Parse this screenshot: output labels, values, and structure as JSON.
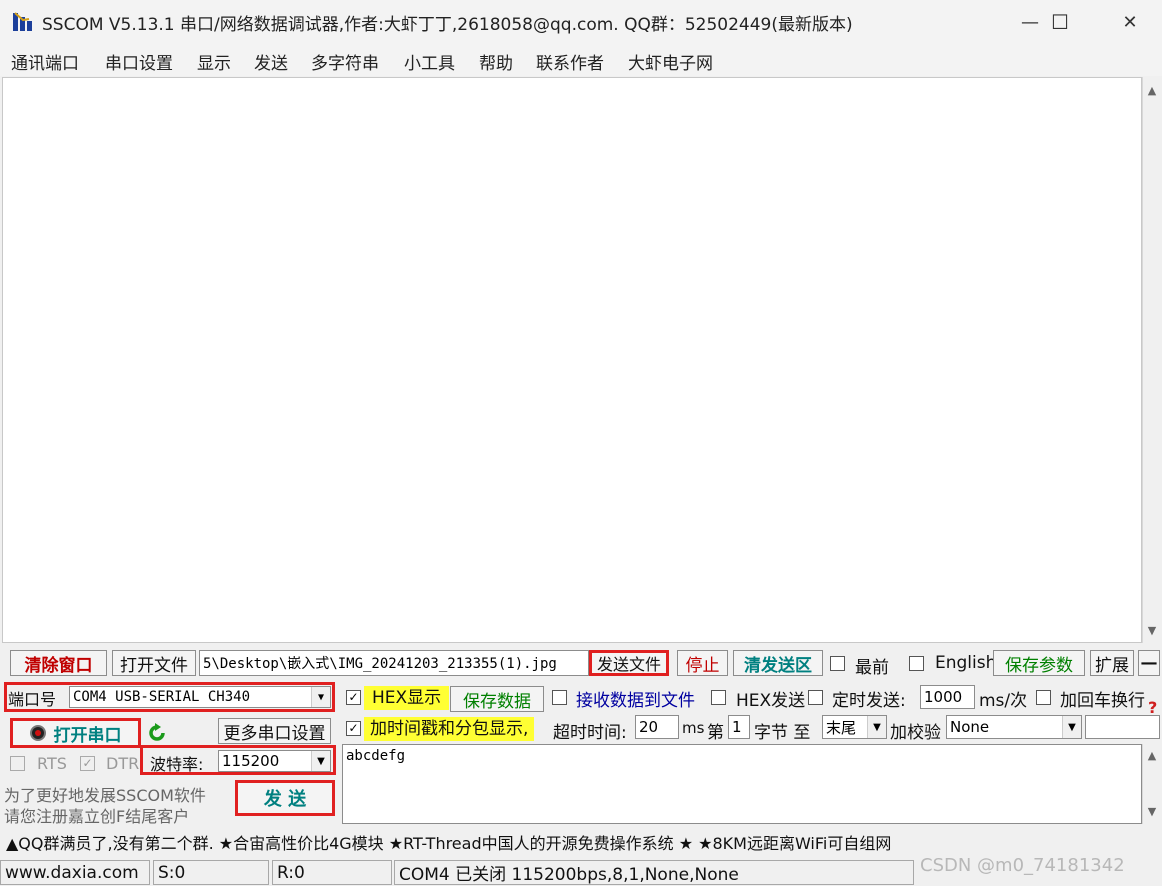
{
  "window": {
    "title": "SSCOM V5.13.1 串口/网络数据调试器,作者:大虾丁丁,2618058@qq.com. QQ群：52502449(最新版本)",
    "minimize": "—",
    "maximize": "☐",
    "close": "✕"
  },
  "menu": [
    "通讯端口",
    "串口设置",
    "显示",
    "发送",
    "多字符串",
    "小工具",
    "帮助",
    "联系作者",
    "大虾电子网"
  ],
  "toolbar": {
    "clear_window": "清除窗口",
    "open_file": "打开文件",
    "file_path": "5\\Desktop\\嵌入式\\IMG_20241203_213355(1).jpg",
    "send_file": "发送文件",
    "stop": "停止",
    "clear_send": "清发送区",
    "last_label": "最前",
    "english_label": "English",
    "save_params": "保存参数",
    "expand": "扩展",
    "collapse": "—"
  },
  "port": {
    "label": "端口号",
    "value": "COM4 USB-SERIAL CH340",
    "open_button": "打开串口",
    "more_settings": "更多串口设置",
    "rts": "RTS",
    "dtr": "DTR",
    "baud_label": "波特率:",
    "baud_value": "115200",
    "promo_line1": "为了更好地发展SSCOM软件",
    "promo_line2": "请您注册嘉立创F结尾客户",
    "send_button": "发 送"
  },
  "options": {
    "hex_display": "HEX显示",
    "save_data": "保存数据",
    "receive_to_file": "接收数据到文件",
    "hex_send": "HEX发送",
    "timed_send": "定时发送:",
    "interval": "1000",
    "interval_unit": "ms/次",
    "add_crlf": "加回车换行",
    "timestamp": "加时间戳和分包显示,",
    "timeout_label": "超时时间:",
    "timeout_value": "20",
    "timeout_unit": "ms",
    "byte_label_1": "第",
    "byte_value": "1",
    "byte_label_2": "字节 至",
    "end_value": "末尾",
    "checksum_label": "加校验",
    "checksum_value": "None",
    "help_mark": "?"
  },
  "send_area": {
    "text": "abcdefg"
  },
  "ticker": "▲QQ群满员了,没有第二个群. ★合宙高性价比4G模块 ★RT-Thread中国人的开源免费操作系统 ★ ★8KM远距离WiFi可自组网",
  "status": {
    "website": "www.daxia.com",
    "sent": "S:0",
    "received": "R:0",
    "port_state": "COM4 已关闭  115200bps,8,1,None,None"
  },
  "watermark": "CSDN @m0_74181342",
  "colors": {
    "highlight": "#ffff33",
    "red_frame": "#e02020",
    "red_text": "#c00000",
    "green_text": "#008000",
    "teal_text": "#008080"
  }
}
